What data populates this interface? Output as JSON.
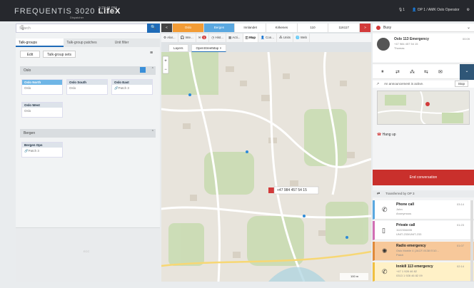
{
  "topbar": {
    "brand": "FREQUENTIS 3020",
    "brand_bold": "LifeX",
    "brand_sub": "Dispatcher",
    "time": "3:23:41 PM",
    "date": "09.01.2023",
    "status": "1",
    "operator": "OP 1 / AMK Oslo Operator"
  },
  "left": {
    "search_placeholder": "Search",
    "tabs": [
      "Talk-groups",
      "Talk-group patches",
      "Unit filter"
    ],
    "edit_label": "Edit",
    "sets_label": "Talk-group sets",
    "groups": [
      {
        "name": "Oslo",
        "cards": [
          {
            "title": "Oslo North",
            "body": "Oslo"
          },
          {
            "title": "Oslo South",
            "body": "Oslo"
          },
          {
            "title": "Oslo East",
            "body": "Patch 3"
          },
          {
            "title": "Oslo West",
            "body": "Oslo"
          }
        ]
      },
      {
        "name": "Bergen",
        "cards": [
          {
            "title": "Bergen Ops",
            "body": "Patch 3"
          }
        ]
      }
    ],
    "footer": "ECC"
  },
  "center": {
    "tabs": [
      "<",
      "Oslo",
      "Bergen",
      "Innlandet",
      "Kirkenes",
      "110",
      "116117",
      ">"
    ],
    "tab_colors": [
      "#444",
      "#f39c35",
      "#5aa8e0",
      "#fff",
      "#fff",
      "#fff",
      "#fff",
      "#d23a3a"
    ],
    "subtabs": [
      "Alar...",
      "Inte...",
      "1",
      "Hist...",
      "Acti...",
      "Map",
      "Con...",
      "Units",
      "Web"
    ],
    "map_tabs": [
      "Layers",
      "OpenStreetMap"
    ],
    "pin_label": "+47 984 457 54 15",
    "scale": "100 m"
  },
  "right": {
    "status": "Busy",
    "active_call": {
      "title": "Oslo 113 Emergency",
      "number": "+47 984 457 54 15",
      "name": "Thomas",
      "time": "00:09"
    },
    "announce": "An announcement is active.",
    "stop": "Stop",
    "hangup": "Hang up",
    "end": "End conversation",
    "transferred": "Transferred by OP 3",
    "queue": [
      {
        "title": "Phone call",
        "l1": "John",
        "l2": "Anonymous",
        "time": "03:14",
        "bg": "#ffffff"
      },
      {
        "title": "Private call",
        "l1": "1122334455",
        "l2": "UNIT-233/UNIT-233",
        "time": "01:23",
        "bg": "#ffffff"
      },
      {
        "title": "Radio emergency",
        "l1": "Oslo Mobile 4 (JACF-9138 E/10...",
        "l2": "Patch",
        "time": "01:07",
        "bg": "#f7c89a"
      },
      {
        "title": "Innkill 113 emergency",
        "l1": "+47 1 928 46 82",
        "l2": "0313 1 928 46 82 09",
        "time": "02:14",
        "bg": "#fff1c7"
      }
    ]
  }
}
